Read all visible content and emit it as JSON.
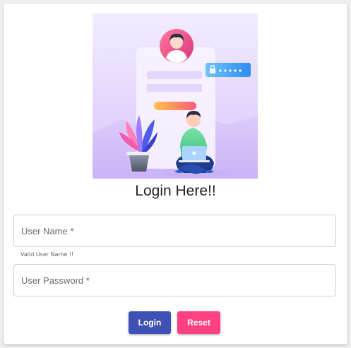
{
  "form": {
    "title": "Login Here!!",
    "username": {
      "placeholder": "User Name *",
      "value": "",
      "helper": "Valid User Name !!"
    },
    "password": {
      "placeholder": "User Password *",
      "value": ""
    },
    "buttons": {
      "login_label": "Login",
      "reset_label": "Reset"
    }
  },
  "illustration": {
    "name": "login-illustration",
    "icons": [
      "avatar-icon",
      "lock-icon",
      "laptop-icon",
      "plant-icon"
    ]
  },
  "colors": {
    "primary": "#3f51b5",
    "accent": "#ff4081",
    "illustration_bg": "#ece3fd"
  }
}
